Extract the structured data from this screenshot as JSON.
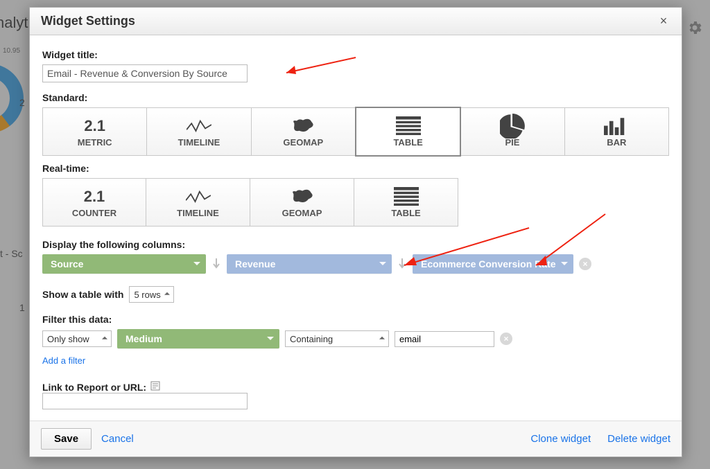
{
  "background": {
    "analytics_fragment": "nalyt",
    "pct_label": "10.95",
    "num_a": "2",
    "row_fragment": "t - Sc",
    "num_b": "1"
  },
  "modal": {
    "title": "Widget Settings",
    "close_glyph": "×",
    "widget_title_label": "Widget title:",
    "widget_title_value": "Email - Revenue & Conversion By Source",
    "standard_label": "Standard:",
    "standard_types": [
      {
        "id": "metric",
        "label": "METRIC",
        "icon": "2.1"
      },
      {
        "id": "timeline",
        "label": "TIMELINE"
      },
      {
        "id": "geomap",
        "label": "GEOMAP"
      },
      {
        "id": "table",
        "label": "TABLE",
        "selected": true
      },
      {
        "id": "pie",
        "label": "PIE"
      },
      {
        "id": "bar",
        "label": "BAR"
      }
    ],
    "realtime_label": "Real-time:",
    "realtime_types": [
      {
        "id": "counter",
        "label": "COUNTER",
        "icon": "2.1"
      },
      {
        "id": "timeline",
        "label": "TIMELINE"
      },
      {
        "id": "geomap",
        "label": "GEOMAP"
      },
      {
        "id": "table",
        "label": "TABLE"
      }
    ],
    "columns_label": "Display the following columns:",
    "columns": {
      "dimension": "Source",
      "metric1": "Revenue",
      "metric2": "Ecommerce Conversion Rate"
    },
    "table_size_label": "Show a table with",
    "table_size_value": "5 rows",
    "filter_label": "Filter this data:",
    "filter": {
      "mode": "Only show",
      "dimension": "Medium",
      "condition": "Containing",
      "value": "email"
    },
    "add_filter_label": "Add a filter",
    "link_label": "Link to Report or URL:",
    "link_value": "",
    "footer": {
      "save": "Save",
      "cancel": "Cancel",
      "clone": "Clone widget",
      "delete": "Delete widget"
    }
  }
}
